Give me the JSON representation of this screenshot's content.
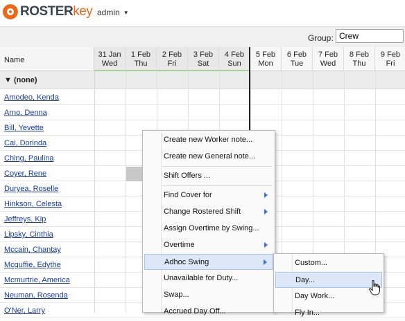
{
  "app": {
    "logo_roster": "ROSTER",
    "logo_key": "key",
    "user": "admin"
  },
  "toolbar": {
    "group_label": "Group:",
    "group_value": "Crew"
  },
  "grid": {
    "name_header": "Name",
    "days": [
      {
        "date": "31 Jan",
        "dow": "Wed",
        "state": "past"
      },
      {
        "date": "1 Feb",
        "dow": "Thu",
        "state": "past"
      },
      {
        "date": "2 Feb",
        "dow": "Fri",
        "state": "past"
      },
      {
        "date": "3 Feb",
        "dow": "Sat",
        "state": "past"
      },
      {
        "date": "4 Feb",
        "dow": "Sun",
        "state": "past"
      },
      {
        "date": "5 Feb",
        "dow": "Mon",
        "state": "future"
      },
      {
        "date": "6 Feb",
        "dow": "Tue",
        "state": "future"
      },
      {
        "date": "7 Feb",
        "dow": "Wed",
        "state": "future"
      },
      {
        "date": "8 Feb",
        "dow": "Thu",
        "state": "future"
      },
      {
        "date": "9 Feb",
        "dow": "Fri",
        "state": "future"
      }
    ],
    "group_name": "▼ (none)",
    "workers": [
      "Amodeo, Kenda",
      "Arno, Denna",
      "Bill, Yevette",
      "Cai, Dorinda",
      "Ching, Paulina",
      "Coyer, Rene",
      "Duryea, Roselle",
      "Hinkson, Celesta",
      "Jeffreys, Kip",
      "Lipsky, Cinthia",
      "Mccain, Chantay",
      "Mcguffie, Edythe",
      "Mcmurtrie, America",
      "Neuman, Rosenda",
      "O'Ner, Larry"
    ]
  },
  "context_menu": {
    "items": [
      {
        "label": "Create new Worker note...",
        "submenu": false
      },
      {
        "label": "Create new General note...",
        "submenu": false
      },
      {
        "label": "Shift Offers ...",
        "submenu": false
      },
      {
        "label": "Find Cover for",
        "submenu": true
      },
      {
        "label": "Change Rostered Shift",
        "submenu": true
      },
      {
        "label": "Assign Overtime by Swing...",
        "submenu": false
      },
      {
        "label": "Overtime",
        "submenu": true
      },
      {
        "label": "Adhoc Swing",
        "submenu": true
      },
      {
        "label": "Unavailable for Duty...",
        "submenu": false
      },
      {
        "label": "Swap...",
        "submenu": false
      },
      {
        "label": "Accrued Day Off...",
        "submenu": false
      }
    ]
  },
  "submenu": {
    "items": [
      {
        "label": "Custom..."
      },
      {
        "label": "Day..."
      },
      {
        "label": "Day Work..."
      },
      {
        "label": "Fly In..."
      }
    ]
  },
  "colors": {
    "brand_orange": "#e8681c",
    "link_blue": "#1a3b9c",
    "menu_hover": "#dce7f7",
    "submenu_arrow": "#3a6fd8"
  }
}
